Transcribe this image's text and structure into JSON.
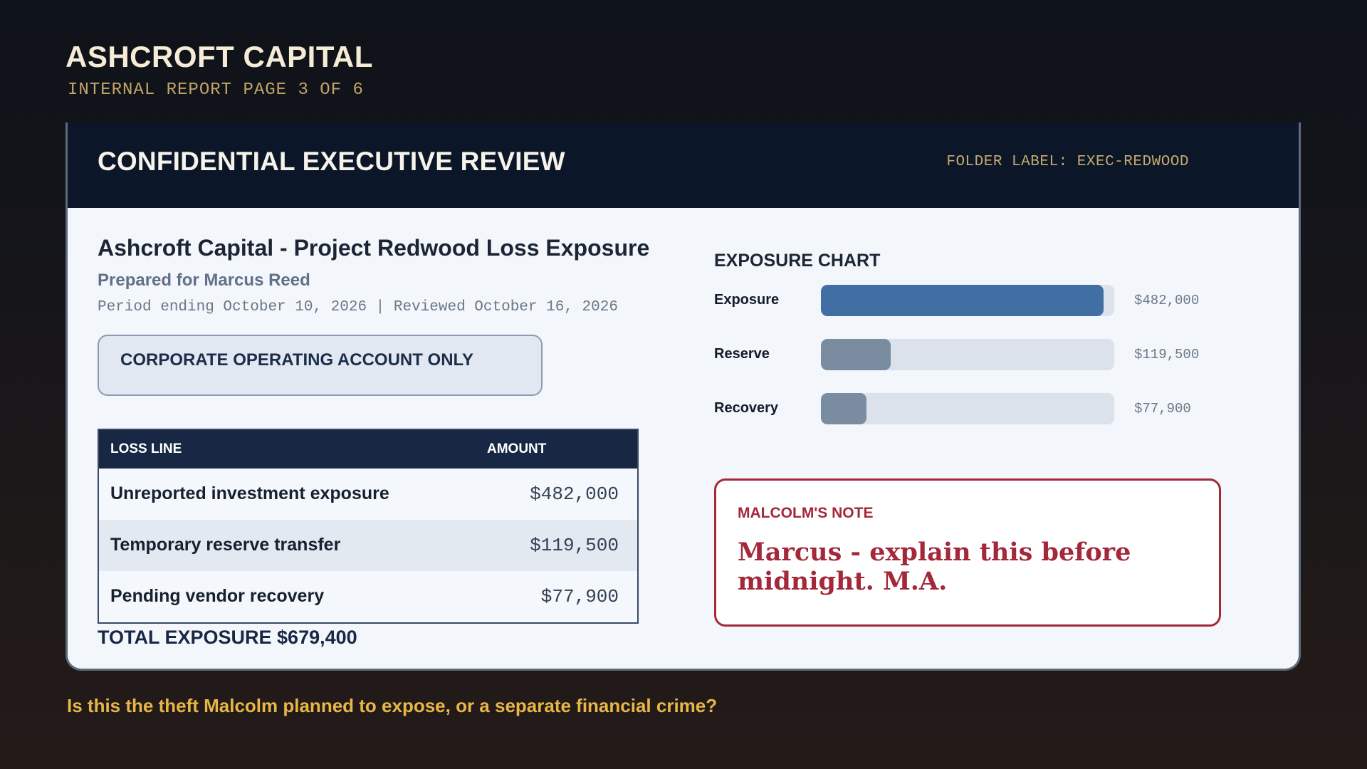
{
  "brand": "ASHCROFT CAPITAL",
  "page_indicator": "INTERNAL REPORT PAGE 3 OF 6",
  "card": {
    "title": "CONFIDENTIAL EXECUTIVE REVIEW",
    "folder_label": "FOLDER LABEL: EXEC-REDWOOD"
  },
  "report": {
    "title": "Ashcroft Capital - Project Redwood Loss Exposure",
    "prepared_for": "Prepared for Marcus Reed",
    "period": "Period ending October 10, 2026 | Reviewed October 16, 2026",
    "restriction": "CORPORATE OPERATING ACCOUNT ONLY"
  },
  "table": {
    "headers": [
      "LOSS LINE",
      "AMOUNT"
    ],
    "rows": [
      {
        "label": "Unreported investment exposure",
        "amount": "$482,000"
      },
      {
        "label": "Temporary reserve transfer",
        "amount": "$119,500"
      },
      {
        "label": "Pending vendor recovery",
        "amount": "$77,900"
      }
    ],
    "total": "TOTAL EXPOSURE $679,400"
  },
  "chart_data": {
    "type": "bar",
    "orientation": "horizontal",
    "title": "EXPOSURE CHART",
    "categories": [
      "Exposure",
      "Reserve",
      "Recovery"
    ],
    "values": [
      482000,
      119500,
      77900
    ],
    "value_labels": [
      "$482,000",
      "$119,500",
      "$77,900"
    ],
    "xlim": [
      0,
      500000
    ],
    "colors": [
      "#426fa3",
      "#7a8ca0",
      "#7a8ca0"
    ],
    "track_color": "#dbe2eb",
    "grid": false
  },
  "note": {
    "title": "MALCOLM'S NOTE",
    "body": "Marcus - explain this before midnight. M.A."
  },
  "question": "Is this the theft Malcolm planned to expose, or a separate financial crime?",
  "colors": {
    "header_bg": "#0b1728",
    "card_bg": "#f3f6fa",
    "table_header_bg": "#182844",
    "accent_gold": "#c7a86d",
    "note_red": "#a3283a",
    "question_gold": "#e8b646"
  }
}
